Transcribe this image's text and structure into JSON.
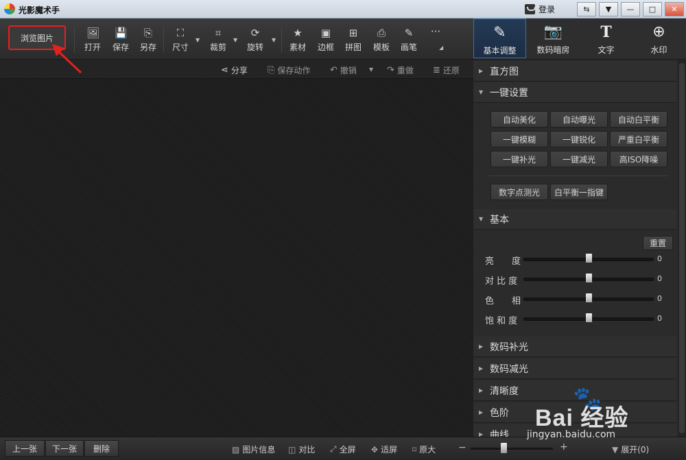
{
  "titlebar": {
    "app_title": "光影魔术手",
    "login_label": "登录",
    "window_buttons": [
      "⇆",
      "▼",
      "—",
      "□",
      "✕"
    ]
  },
  "toolbar": {
    "browse_label": "浏览图片",
    "tools": [
      {
        "label": "打开",
        "icon": "🖼"
      },
      {
        "label": "保存",
        "icon": "💾"
      },
      {
        "label": "另存",
        "icon": "⎘"
      },
      {
        "label": "尺寸",
        "icon": "⛶"
      },
      {
        "label": "裁剪",
        "icon": "⌗"
      },
      {
        "label": "旋转",
        "icon": "⟳"
      },
      {
        "label": "素材",
        "icon": "★"
      },
      {
        "label": "边框",
        "icon": "▣"
      },
      {
        "label": "拼图",
        "icon": "⊞"
      },
      {
        "label": "模板",
        "icon": "⎙"
      },
      {
        "label": "画笔",
        "icon": "✎"
      }
    ],
    "more_icon": "···"
  },
  "right_tabs": [
    {
      "label": "基本调整",
      "icon": "✎",
      "active": true
    },
    {
      "label": "数码暗房",
      "icon": "📷",
      "active": false
    },
    {
      "label": "文字",
      "icon": "T",
      "active": false
    },
    {
      "label": "水印",
      "icon": "⊕",
      "active": false
    }
  ],
  "action_bar": {
    "share": "分享",
    "save_action": "保存动作",
    "undo": "撤销",
    "redo": "重做",
    "restore": "还原"
  },
  "panel": {
    "histogram": "直方图",
    "one_click": {
      "title": "一键设置",
      "buttons": [
        "自动美化",
        "自动曝光",
        "自动白平衡",
        "一键模糊",
        "一键锐化",
        "严重白平衡",
        "一键补光",
        "一键减光",
        "高ISO降噪"
      ],
      "extra_buttons": [
        "数字点测光",
        "白平衡一指键"
      ]
    },
    "basic": {
      "title": "基本",
      "reset": "重置",
      "sliders": [
        {
          "label": "亮　　度",
          "value": "0",
          "level": 0.5
        },
        {
          "label": "对 比 度",
          "value": "0",
          "level": 0.5
        },
        {
          "label": "色　　相",
          "value": "0",
          "level": 0.5
        },
        {
          "label": "饱 和 度",
          "value": "0",
          "level": 0.5
        }
      ]
    },
    "sections": [
      "数码补光",
      "数码减光",
      "清晰度",
      "色阶",
      "曲线"
    ]
  },
  "bottom": {
    "prev": "上一张",
    "next": "下一张",
    "delete": "删除",
    "image_info": "图片信息",
    "compare": "对比",
    "fullscreen": "全屏",
    "fit": "适屏",
    "original": "原大",
    "expand": "展开(0)",
    "zoom_level": 0.4
  },
  "watermark": {
    "brand": "Bai  经验",
    "url": "jingyan.baidu.com"
  },
  "colors": {
    "annotation_red": "#e3211e",
    "active_tab_border": "#3d6fa7"
  }
}
